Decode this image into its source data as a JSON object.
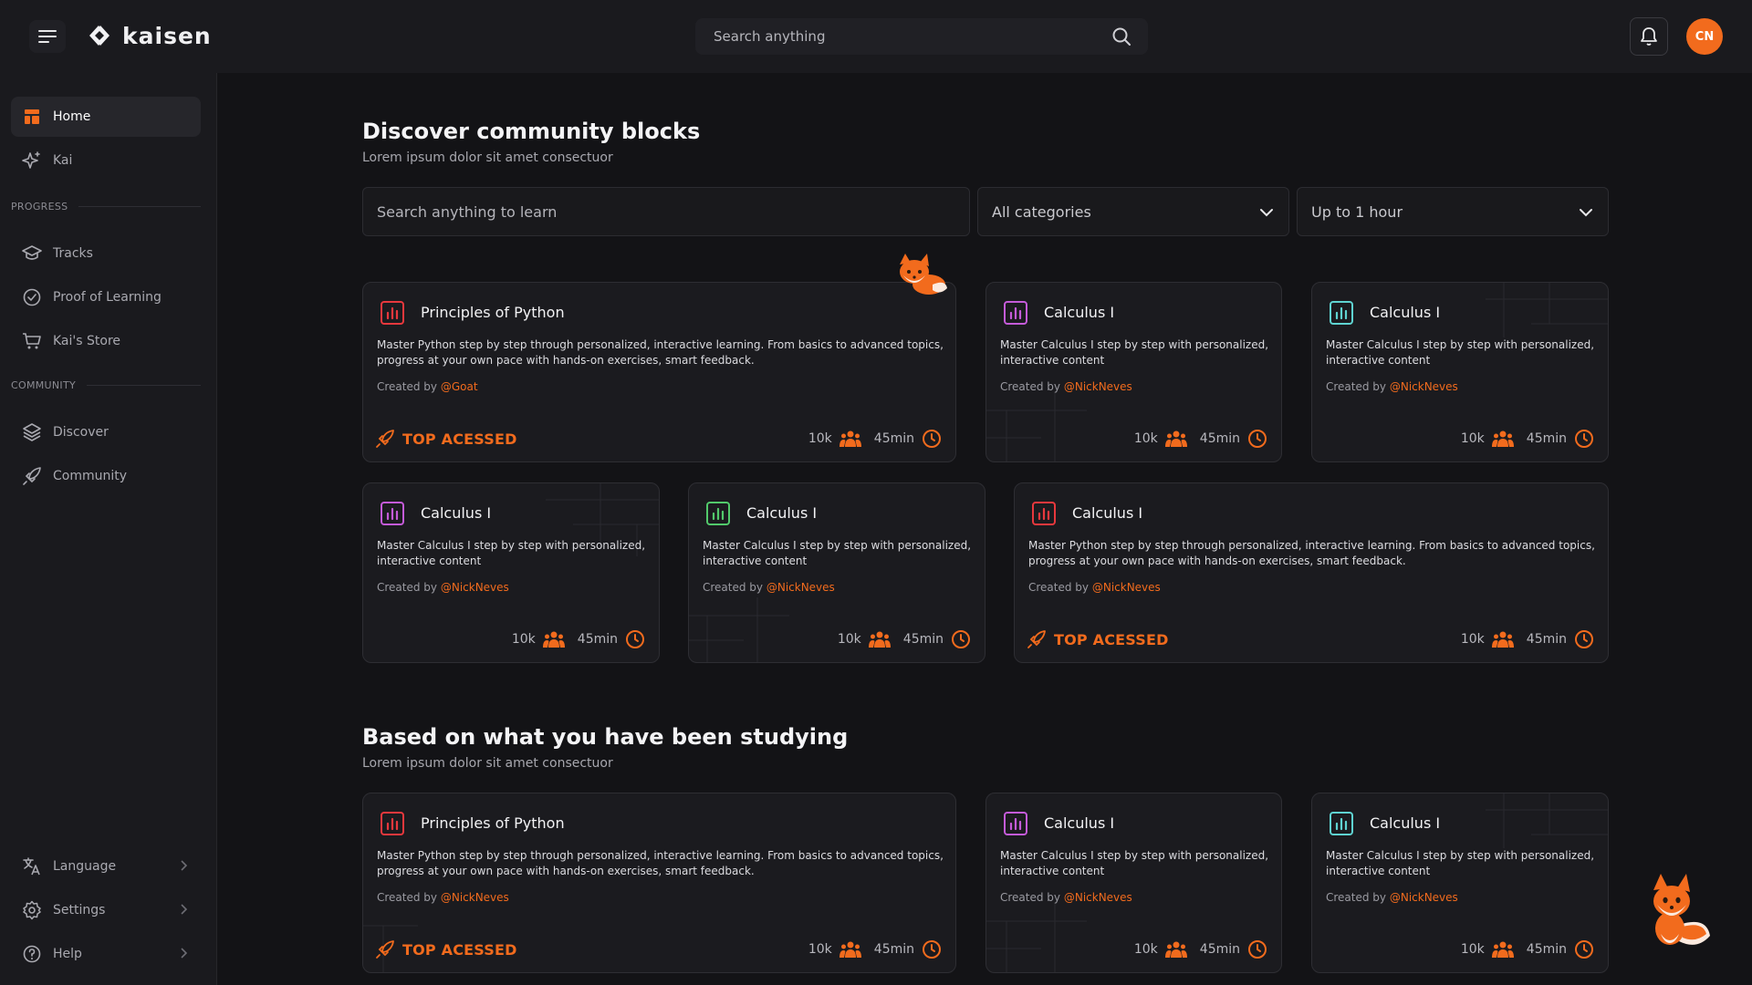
{
  "app": {
    "name": "kaisen"
  },
  "header": {
    "search_placeholder": "Search anything",
    "avatar_initials": "CN"
  },
  "sidebar": {
    "items": [
      {
        "label": "Home",
        "icon": "home-icon",
        "active": true
      },
      {
        "label": "Kai",
        "icon": "sparkle-icon"
      }
    ],
    "progress_label": "PROGRESS",
    "progress_items": [
      {
        "label": "Tracks",
        "icon": "graduation-cap-icon"
      },
      {
        "label": "Proof of Learning",
        "icon": "check-circle-icon"
      },
      {
        "label": "Kai's Store",
        "icon": "cart-icon"
      }
    ],
    "community_label": "COMMUNITY",
    "community_items": [
      {
        "label": "Discover",
        "icon": "layers-icon"
      },
      {
        "label": "Community",
        "icon": "rocket-icon"
      }
    ],
    "bottom_items": [
      {
        "label": "Language",
        "icon": "translate-icon"
      },
      {
        "label": "Settings",
        "icon": "gear-icon"
      },
      {
        "label": "Help",
        "icon": "help-circle-icon"
      }
    ]
  },
  "discover": {
    "title": "Discover community blocks",
    "subtitle": "Lorem ipsum dolor sit amet consectuor",
    "search_placeholder": "Search anything to learn",
    "category_select": "All categories",
    "duration_select": "Up to 1 hour"
  },
  "studying": {
    "title": "Based on what you have been studying",
    "subtitle": "Lorem ipsum dolor sit amet consectuor"
  },
  "colors": {
    "accent": "#f26b1d",
    "icon_red": "#e8383d",
    "icon_purple": "#c45bd8",
    "icon_teal": "#5fd3d1",
    "icon_green": "#52c96b"
  },
  "cards": [
    {
      "title": "Principles of Python",
      "desc1": "Master Python step by step through personalized, interactive learning. From basics to advanced topics,",
      "desc2": "progress at your own pace with hands-on exercises, smart feedback.",
      "created_by": "Created by ",
      "author": "@Goat",
      "badge": "TOP ACESSED",
      "users": "10k",
      "duration": "45min"
    },
    {
      "title": "Calculus I",
      "desc1": "Master Calculus I step by step with personalized,",
      "desc2": "interactive content",
      "created_by": "Created by ",
      "author": "@NickNeves",
      "users": "10k",
      "duration": "45min"
    },
    {
      "title": "Calculus I",
      "desc1": "Master Calculus I step by step with personalized,",
      "desc2": "interactive content",
      "created_by": "Created by ",
      "author": "@NickNeves",
      "users": "10k",
      "duration": "45min"
    },
    {
      "title": "Calculus I",
      "desc1": "Master Calculus I step by step with personalized,",
      "desc2": "interactive content",
      "created_by": "Created by ",
      "author": "@NickNeves",
      "users": "10k",
      "duration": "45min"
    },
    {
      "title": "Calculus I",
      "desc1": "Master Calculus I step by step with personalized,",
      "desc2": "interactive content",
      "created_by": "Created by ",
      "author": "@NickNeves",
      "users": "10k",
      "duration": "45min"
    },
    {
      "title": "Calculus I",
      "desc1": "Master Python step by step through personalized, interactive learning. From basics to advanced topics,",
      "desc2": "progress at your own pace with hands-on exercises, smart feedback.",
      "created_by": "Created by ",
      "author": "@NickNeves",
      "badge": "TOP ACESSED",
      "users": "10k",
      "duration": "45min"
    },
    {
      "title": "Principles of Python",
      "desc1": "Master Python step by step through personalized, interactive learning. From basics to advanced topics,",
      "desc2": "progress at your own pace with hands-on exercises, smart feedback.",
      "created_by": "Created by ",
      "author": "@NickNeves",
      "badge": "TOP ACESSED",
      "users": "10k",
      "duration": "45min"
    },
    {
      "title": "Calculus I",
      "desc1": "Master Calculus I step by step with personalized,",
      "desc2": "interactive content",
      "created_by": "Created by ",
      "author": "@NickNeves",
      "users": "10k",
      "duration": "45min"
    },
    {
      "title": "Calculus I",
      "desc1": "Master Calculus I step by step with personalized,",
      "desc2": "interactive content",
      "created_by": "Created by ",
      "author": "@NickNeves",
      "users": "10k",
      "duration": "45min"
    }
  ]
}
